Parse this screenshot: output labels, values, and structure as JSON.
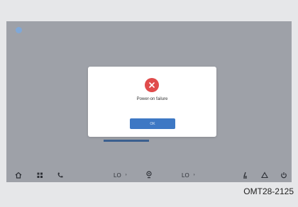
{
  "dialog": {
    "message": "Power-on failure",
    "ok_label": "OK"
  },
  "background": {
    "left_text": "Unreadable blurred text\nbehind overlay",
    "right_text": "Unreadable blurred text\nbehind overlay"
  },
  "dock": {
    "left_temp": "LO",
    "right_temp": "LO"
  },
  "caption": "OMT28-2125",
  "colors": {
    "screen": "#9ea1a8",
    "error": "#e04b4b",
    "button": "#3e78c4"
  }
}
